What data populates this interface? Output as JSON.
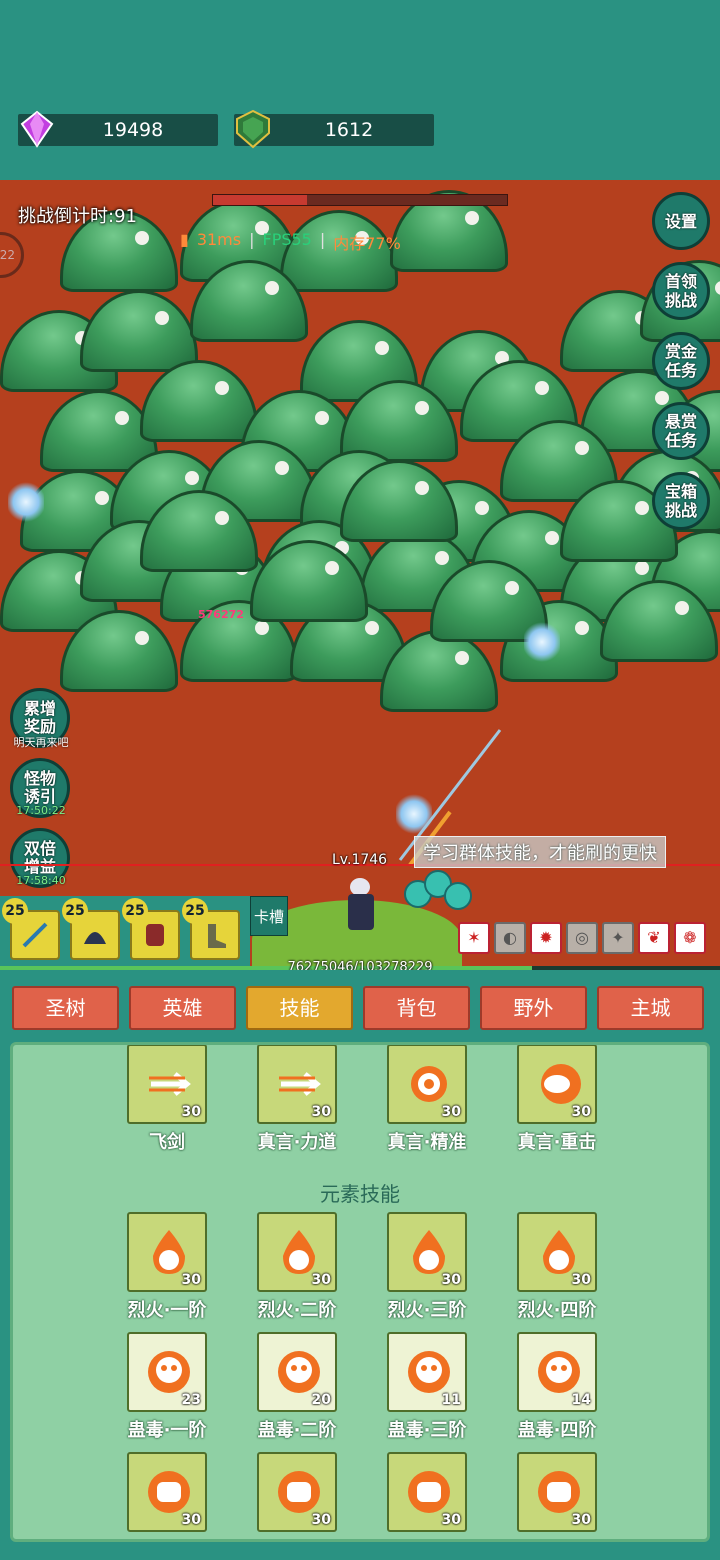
{
  "currency": {
    "gems": "19498",
    "shields": "1612"
  },
  "battle": {
    "timer": "挑战倒计时:91",
    "perf": {
      "ping": "31ms",
      "fps": "FPS55",
      "mem": "内存77%",
      "sep": "|"
    },
    "left_edge_badge": "22",
    "damage_number": "576272",
    "tip": "学习群体技能，才能刷的更快",
    "hero_level": "Lv.1746",
    "xp_text": "76275046/103278229",
    "xp_fraction": 0.7385,
    "boss_hp_fraction": 0.32
  },
  "right_buttons": [
    {
      "label": "设置"
    },
    {
      "label": "首领挑战"
    },
    {
      "label": "赏金任务"
    },
    {
      "label": "悬赏任务"
    },
    {
      "label": "宝箱挑战"
    }
  ],
  "left_buttons": [
    {
      "label": "累增奖励",
      "sub": "明天再来吧"
    },
    {
      "label": "怪物诱引",
      "sub": "17:50:22"
    },
    {
      "label": "双倍增益",
      "sub": "17:58:40"
    }
  ],
  "cards": [
    {
      "level": "25",
      "item": "sword"
    },
    {
      "level": "25",
      "item": "helmet"
    },
    {
      "level": "25",
      "item": "armor"
    },
    {
      "level": "25",
      "item": "boots"
    }
  ],
  "card_slot_label": "卡槽",
  "buffs": [
    "✶",
    "◐",
    "✹",
    "◎",
    "✦",
    "❦",
    "❁"
  ],
  "tabs": [
    {
      "label": "圣树",
      "active": false
    },
    {
      "label": "英雄",
      "active": false
    },
    {
      "label": "技能",
      "active": true
    },
    {
      "label": "背包",
      "active": false
    },
    {
      "label": "野外",
      "active": false
    },
    {
      "label": "主城",
      "active": false
    }
  ],
  "skills_row1": [
    {
      "name": "飞剑",
      "level": "30",
      "icon": "flying-sword-icon"
    },
    {
      "name": "真言·力道",
      "level": "30",
      "icon": "mantra-strength-icon"
    },
    {
      "name": "真言·精准",
      "level": "30",
      "icon": "target-icon"
    },
    {
      "name": "真言·重击",
      "level": "30",
      "icon": "fist-icon"
    }
  ],
  "section_title": "元素技能",
  "skills_fire": [
    {
      "name": "烈火·一阶",
      "level": "30"
    },
    {
      "name": "烈火·二阶",
      "level": "30"
    },
    {
      "name": "烈火·三阶",
      "level": "30"
    },
    {
      "name": "烈火·四阶",
      "level": "30"
    }
  ],
  "skills_poison": [
    {
      "name": "蛊毒·一阶",
      "level": "23"
    },
    {
      "name": "蛊毒·二阶",
      "level": "20"
    },
    {
      "name": "蛊毒·三阶",
      "level": "11"
    },
    {
      "name": "蛊毒·四阶",
      "level": "14"
    }
  ],
  "skills_row4": [
    {
      "level": "30"
    },
    {
      "level": "30"
    },
    {
      "level": "30"
    },
    {
      "level": "30"
    }
  ],
  "colors": {
    "bg_teal": "#2a9282",
    "field": "#b5401e",
    "tab": "#e0624a",
    "tab_active": "#e3a82e",
    "panel": "#8fd0a4"
  }
}
